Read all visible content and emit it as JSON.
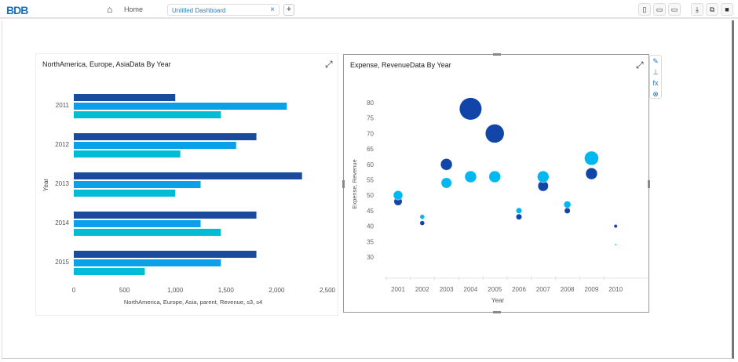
{
  "header": {
    "logo": "BDB",
    "home_label": "Home",
    "tab_label": "Untitled Dashboard",
    "tab_close": "×",
    "add_tab": "+",
    "tools": [
      {
        "icon": "mobile-icon",
        "glyph": "▯"
      },
      {
        "icon": "tablet-icon",
        "glyph": "▭"
      },
      {
        "icon": "desktop-icon",
        "glyph": "▭"
      },
      {
        "icon": "download-icon",
        "glyph": "⤓"
      },
      {
        "icon": "copy-icon",
        "glyph": "⧉"
      },
      {
        "icon": "save-icon",
        "glyph": "■"
      }
    ]
  },
  "side_toolbar": [
    {
      "icon": "edit-icon",
      "glyph": "✎"
    },
    {
      "icon": "axis-icon",
      "glyph": "⊥"
    },
    {
      "icon": "fx-icon",
      "glyph": "fx"
    },
    {
      "icon": "close-circle-icon",
      "glyph": "⊗"
    }
  ],
  "colors": {
    "dark": "#1a4c9e",
    "mid": "#0aa0ea",
    "light": "#00bcd4",
    "bubble_dark": "#1146a8",
    "bubble_light": "#00b8f0"
  },
  "chart_data": [
    {
      "type": "bar",
      "orientation": "horizontal",
      "title": "NorthAmerica, Europe, AsiaData By Year",
      "xlabel": "NorthAmerica, Europe, Asia, parent, Revenue, s3, s4",
      "ylabel": "Year",
      "categories": [
        "2011",
        "2012",
        "2013",
        "2014",
        "2015"
      ],
      "series": [
        {
          "values": [
            1000,
            1800,
            2250,
            1800,
            1800
          ]
        },
        {
          "values": [
            2100,
            1600,
            1250,
            1250,
            1450
          ]
        },
        {
          "values": [
            1450,
            1050,
            1000,
            1450,
            700
          ]
        }
      ],
      "xlim": [
        0,
        2500
      ],
      "xticks": [
        "0",
        "500",
        "1,000",
        "1,500",
        "2,000",
        "2,500"
      ],
      "grid": false
    },
    {
      "type": "scatter",
      "subtype": "bubble",
      "title": "Expense, RevenueData By Year",
      "xlabel": "Year",
      "ylabel": "Expense, Revenue",
      "categories": [
        "2001",
        "2002",
        "2003",
        "2004",
        "2005",
        "2006",
        "2007",
        "2008",
        "2009",
        "2010"
      ],
      "series": [
        {
          "values": [
            48,
            41,
            60,
            78,
            70,
            43,
            53,
            45,
            57,
            40
          ],
          "sizes": [
            7,
            4,
            10,
            19,
            16,
            5,
            9,
            5,
            10,
            3
          ]
        },
        {
          "values": [
            50,
            43,
            54,
            56,
            56,
            45,
            56,
            47,
            62,
            34
          ],
          "sizes": [
            8,
            4,
            9,
            10,
            10,
            5,
            10,
            6,
            12,
            1.5
          ]
        }
      ],
      "ylim": [
        26,
        82
      ],
      "yticks": [
        "30",
        "35",
        "40",
        "45",
        "50",
        "55",
        "60",
        "65",
        "70",
        "75",
        "80"
      ],
      "grid": false
    }
  ]
}
